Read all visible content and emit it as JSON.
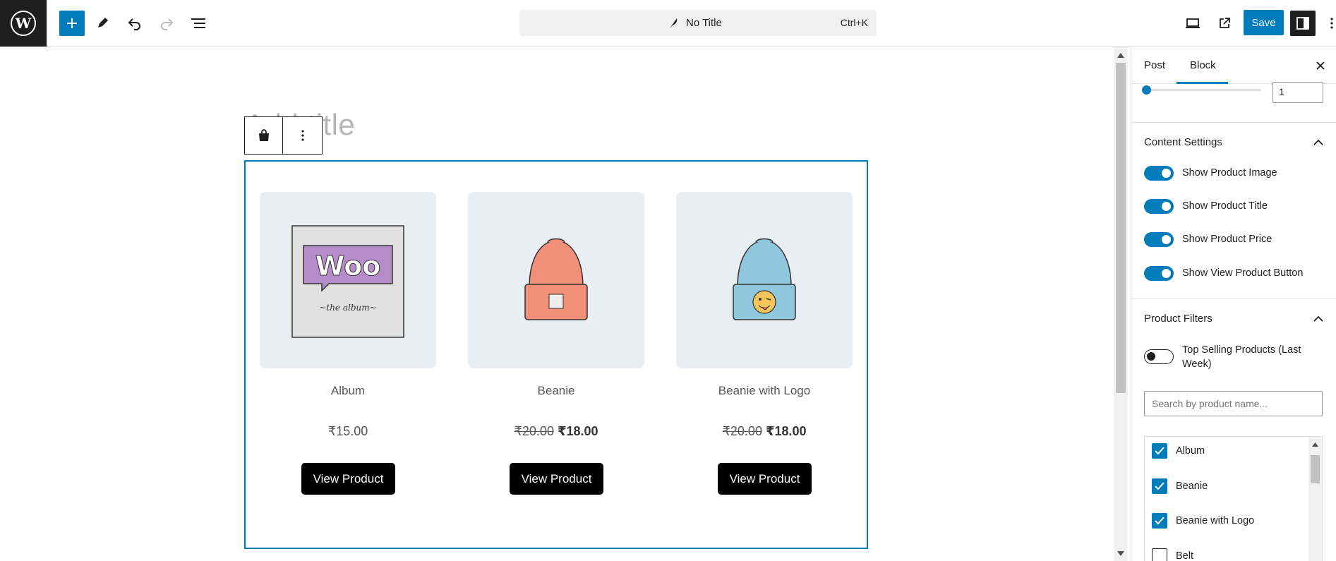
{
  "topbar": {
    "doc_title": "No Title",
    "shortcut": "Ctrl+K",
    "save_label": "Save"
  },
  "canvas": {
    "title_placeholder": "Add title",
    "products": [
      {
        "name": "Album",
        "price_regular": "",
        "price_current": "₹15.00",
        "on_sale": false
      },
      {
        "name": "Beanie",
        "price_regular": "₹20.00",
        "price_current": "₹18.00",
        "on_sale": true
      },
      {
        "name": "Beanie with Logo",
        "price_regular": "₹20.00",
        "price_current": "₹18.00",
        "on_sale": true
      }
    ],
    "button_label": "View Product"
  },
  "sidebar": {
    "tabs": [
      {
        "label": "Post",
        "active": false
      },
      {
        "label": "Block",
        "active": true
      }
    ],
    "range_value": "1",
    "content_settings": {
      "heading": "Content Settings",
      "toggles": [
        {
          "label": "Show Product Image",
          "on": true
        },
        {
          "label": "Show Product Title",
          "on": true
        },
        {
          "label": "Show Product Price",
          "on": true
        },
        {
          "label": "Show View Product Button",
          "on": true
        }
      ]
    },
    "product_filters": {
      "heading": "Product Filters",
      "top_selling_label": "Top Selling Products (Last Week)",
      "top_selling_on": false,
      "search_placeholder": "Search by product name...",
      "items": [
        {
          "label": "Album",
          "checked": true
        },
        {
          "label": "Beanie",
          "checked": true
        },
        {
          "label": "Beanie with Logo",
          "checked": true
        },
        {
          "label": "Belt",
          "checked": false
        }
      ]
    }
  },
  "colors": {
    "accent": "#007cba",
    "dark": "#1e1e1e",
    "product_bg": "#e8eef2"
  }
}
